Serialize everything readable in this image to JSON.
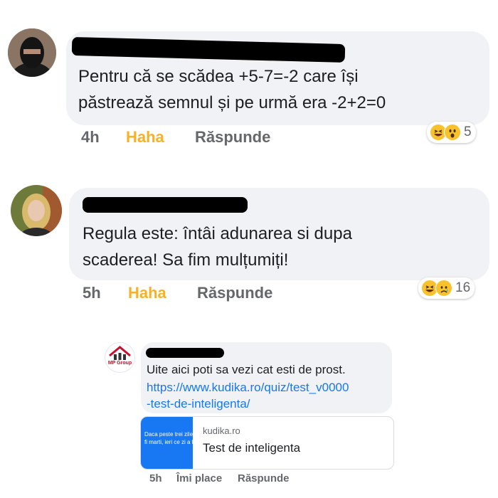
{
  "comments": [
    {
      "text_line1": "Pentru că se scădea +5-7=-2 care își",
      "text_line2": "păstrează semnul și pe urmă era -2+2=0",
      "time": "4h",
      "reaction_label": "Haha",
      "reply_label": "Răspunde",
      "reaction_icons": [
        "haha-emoji",
        "wow-emoji"
      ],
      "reaction_count": "5"
    },
    {
      "text_line1": "Regula este: întâi adunarea si dupa",
      "text_line2": "scaderea! Sa fim mulțumiți!",
      "time": "5h",
      "reaction_label": "Haha",
      "reply_label": "Răspunde",
      "reaction_icons": [
        "haha-emoji",
        "sad-emoji"
      ],
      "reaction_count": "16"
    }
  ],
  "reply": {
    "avatar_text": "MP Group",
    "text": "Uite aici poti sa vezi cat esti de prost.",
    "link_line1": "https://www.kudika.ro/quiz/test_v0000",
    "link_line2": "-test-de-inteligenta/",
    "preview": {
      "thumb_text_line1": "Daca peste trei zile",
      "thumb_text_line2": "fi marti, ieri ce zi a fo",
      "domain": "kudika.ro",
      "title": "Test de inteligenta"
    },
    "time": "5h",
    "like_label": "Îmi place",
    "reply_label": "Răspunde"
  },
  "colors": {
    "haha": "#f7b125",
    "link": "#1877f2",
    "bubble": "#f0f2f5",
    "meta": "#65676b"
  }
}
